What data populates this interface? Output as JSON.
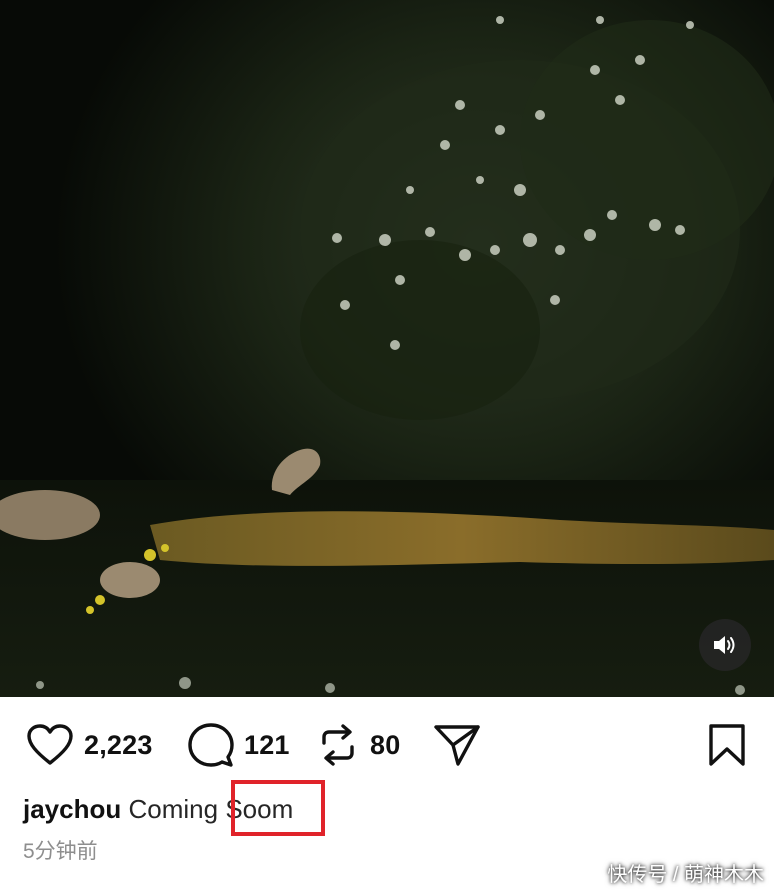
{
  "post": {
    "username": "jaychou",
    "caption": "Coming Soom",
    "caption_part1": "Coming ",
    "caption_highlighted": "Soom",
    "timestamp": "5分钟前"
  },
  "actions": {
    "likes": "2,223",
    "comments": "121",
    "reposts": "80"
  },
  "icons": {
    "like": "heart-icon",
    "comment": "comment-bubble-icon",
    "repost": "repost-icon",
    "share": "send-icon",
    "save": "bookmark-icon",
    "sound": "speaker-icon"
  },
  "colors": {
    "highlight_box": "#e0232a",
    "text_primary": "#111111",
    "text_secondary": "#8e8e8e"
  },
  "watermark": "快传号 / 萌神木木"
}
